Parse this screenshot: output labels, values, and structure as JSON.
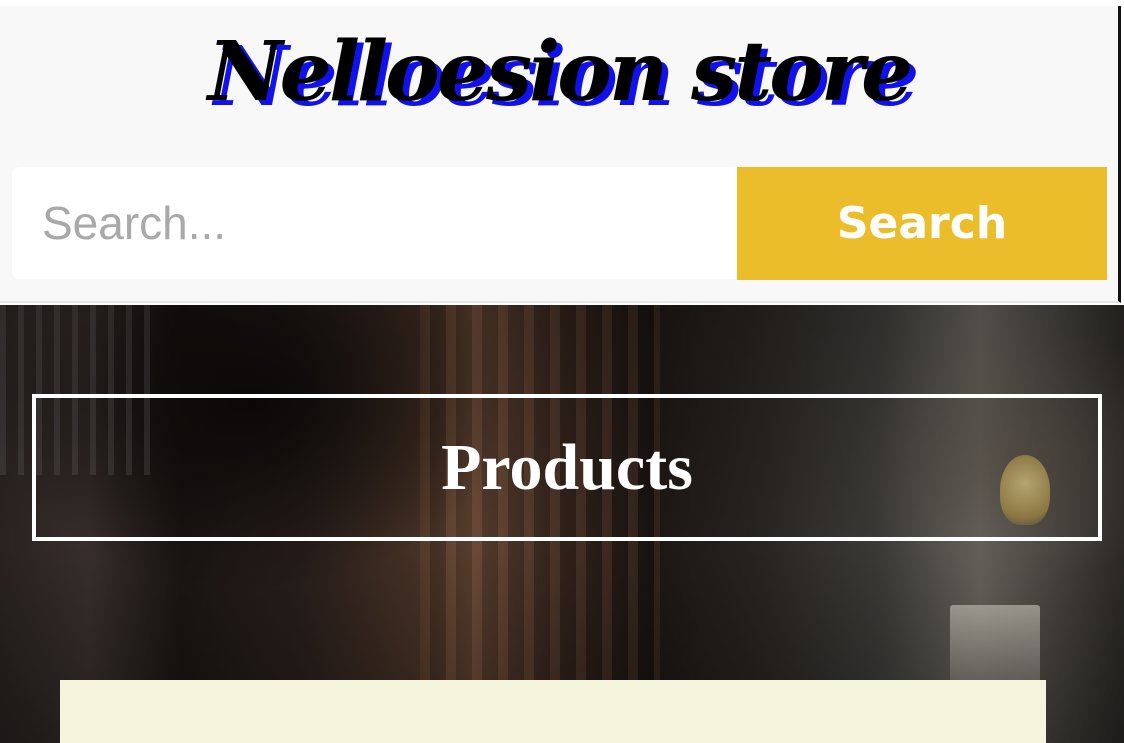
{
  "header": {
    "brand_title": "Nelloesion store",
    "search": {
      "placeholder": "Search...",
      "value": "",
      "button_label": "Search"
    }
  },
  "hero": {
    "section_title": "Products"
  },
  "colors": {
    "header_background": "#f8f8f8",
    "brand_text": "#000000",
    "brand_shadow": "#1111ee",
    "search_button": "#ebbd2b",
    "banner_border": "#ffffff",
    "card_background": "#f5f4dc"
  }
}
